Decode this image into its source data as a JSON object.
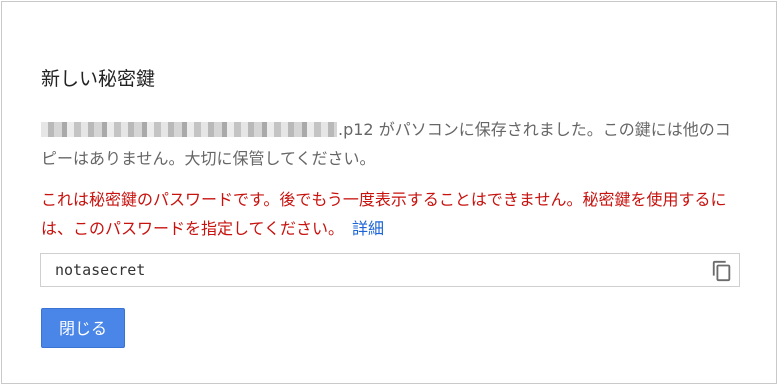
{
  "dialog": {
    "title": "新しい秘密鍵",
    "message": ".p12 がパソコンに保存されました。この鍵には他のコピーはありません。大切に保管してください。",
    "warning": "これは秘密鍵のパスワードです。後でもう一度表示することはできません。秘密鍵を使用するには、このパスワードを指定してください。",
    "details_link": "詳細",
    "password_value": "notasecret",
    "copy_icon": "copy-icon",
    "close_label": "閉じる"
  },
  "colors": {
    "warning": "#c7120e",
    "link": "#1a64d6",
    "button": "#4a86e8"
  }
}
